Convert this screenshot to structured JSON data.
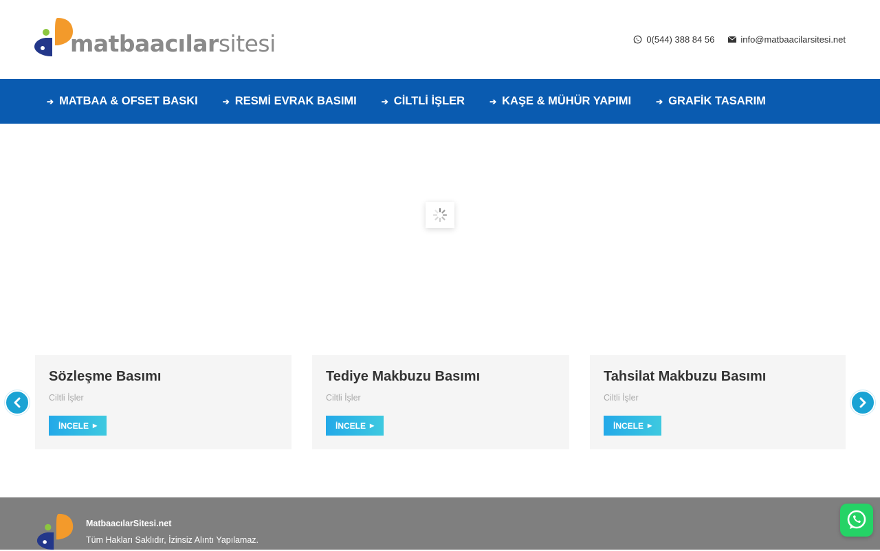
{
  "brand": {
    "logo_bold": "matbaacılar",
    "logo_light": "sitesi"
  },
  "contacts": {
    "phone": "0(544) 388 84 56",
    "email": "info@matbaacilarsitesi.net"
  },
  "nav": {
    "items": [
      {
        "label": "MATBAA & OFSET BASKI"
      },
      {
        "label": "RESMİ EVRAK BASIMI"
      },
      {
        "label": "CİLTLİ İŞLER"
      },
      {
        "label": "KAŞE & MÜHÜR YAPIMI"
      },
      {
        "label": "GRAFİK TASARIM"
      }
    ]
  },
  "cards": [
    {
      "title": "Sözleşme Basımı",
      "category": "Ciltli İşler",
      "button": "İNCELE"
    },
    {
      "title": "Tediye Makbuzu Basımı",
      "category": "Ciltli İşler",
      "button": "İNCELE"
    },
    {
      "title": "Tahsilat Makbuzu Basımı",
      "category": "Ciltli İşler",
      "button": "İNCELE"
    }
  ],
  "footer": {
    "title": "MatbaacılarSitesi.net",
    "copyright": "Tüm Hakları Saklıdır, İzinsiz Alıntı Yapılamaz."
  },
  "colors": {
    "nav_bg": "#0a5bb0",
    "button_accent": "#23a9e8",
    "footer_bg": "#7f7f7f",
    "logo_orange": "#f39a2b",
    "logo_green": "#8cc63f",
    "logo_navy": "#23378a",
    "whatsapp": "#25d366"
  },
  "icons": {
    "phone": "whatsapp-icon",
    "email": "envelope-icon",
    "nav_bullet": "arrow-right-icon",
    "prev": "chevron-left-icon",
    "next": "chevron-right-icon",
    "loader": "spinner-icon",
    "chat": "whatsapp-icon"
  }
}
